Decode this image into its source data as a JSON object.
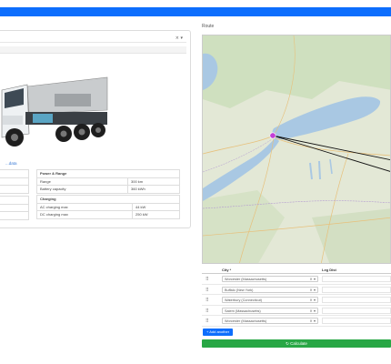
{
  "route": {
    "title": "Route"
  },
  "vehicle_panel": {
    "select_control_icon": "clear-and-chevron",
    "details_link": "...data",
    "power_range": {
      "heading": "Power & Range",
      "rows": [
        {
          "label": "Range",
          "value": "300 km"
        },
        {
          "label": "Battery capacity",
          "value": "360 kWh"
        }
      ]
    },
    "charging": {
      "heading": "Charging",
      "rows": [
        {
          "label": "AC charging max",
          "value": "44 kW"
        },
        {
          "label": "DC charging max",
          "value": "250 kW"
        }
      ]
    }
  },
  "cities": {
    "headers": {
      "city": "City *",
      "leg_dist": "Leg Dist"
    },
    "rows": [
      {
        "value": "Worcester (Massachusetts)"
      },
      {
        "value": "Buffalo (New York)"
      },
      {
        "value": "Waterbury (Connecticut)"
      },
      {
        "value": "Salem (Massachusetts)"
      },
      {
        "value": "Worcester (Massachusetts)"
      }
    ],
    "control": "× ▾"
  },
  "buttons": {
    "add_another": "+ Add another",
    "calculate": "↻ Calculate"
  },
  "colors": {
    "primary": "#0d6efd",
    "success": "#28a745",
    "marker": "#c33fd6",
    "route_line": "#111111"
  }
}
